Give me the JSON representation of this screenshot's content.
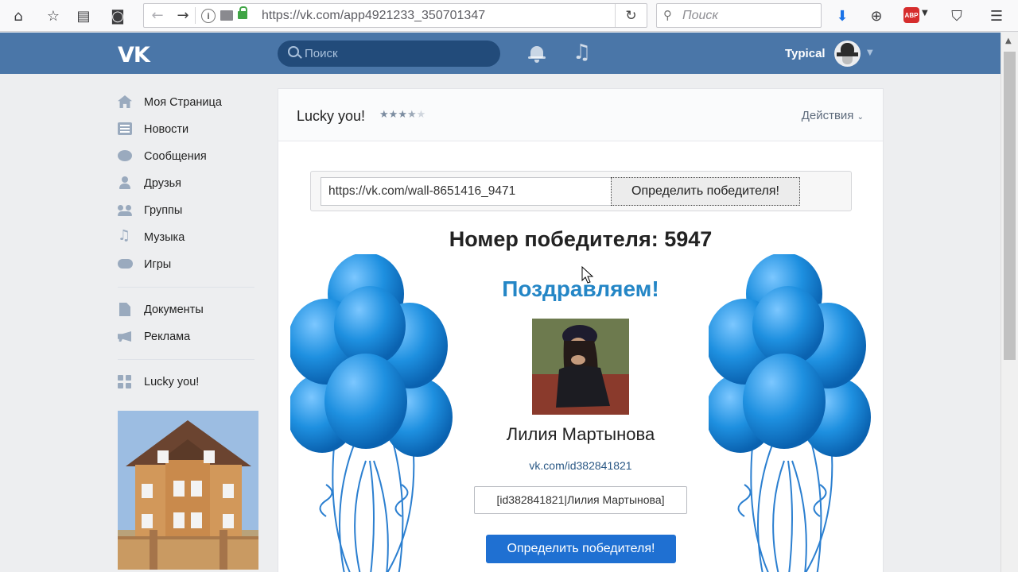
{
  "browser": {
    "url": "https://vk.com/app4921233_350701347",
    "search_placeholder": "Поиск",
    "abp_label": "ABP"
  },
  "vk": {
    "logo": "VK",
    "search_placeholder": "Поиск",
    "username": "Typical"
  },
  "sidebar": {
    "items": [
      {
        "label": "Моя Страница",
        "icon": "home-icon"
      },
      {
        "label": "Новости",
        "icon": "news-icon"
      },
      {
        "label": "Сообщения",
        "icon": "messages-icon"
      },
      {
        "label": "Друзья",
        "icon": "friends-icon"
      },
      {
        "label": "Группы",
        "icon": "groups-icon"
      },
      {
        "label": "Музыка",
        "icon": "music-icon"
      },
      {
        "label": "Игры",
        "icon": "games-icon"
      }
    ],
    "items2": [
      {
        "label": "Документы",
        "icon": "documents-icon"
      },
      {
        "label": "Реклама",
        "icon": "ads-icon"
      }
    ],
    "app_item": {
      "label": "Lucky you!",
      "icon": "apps-icon"
    }
  },
  "app": {
    "title": "Lucky you!",
    "rating": 3.5,
    "rating_max": 5,
    "actions_label": "Действия",
    "post_link": "https://vk.com/wall-8651416_9471",
    "determine_button": "Определить победителя!",
    "winner_number_text": "Номер победителя: 5947",
    "congrats": "Поздравляем!",
    "winner_name": "Лилия Мартынова",
    "winner_link": "vk.com/id382841821",
    "winner_mention": "[id382841821|Лилия Мартынова]",
    "main_button": "Определить победителя!"
  },
  "colors": {
    "vk_header": "#4a76a8",
    "accent_blue": "#2486c6",
    "button_blue": "#1f70d2",
    "balloon_blue": "#1e90e0"
  }
}
